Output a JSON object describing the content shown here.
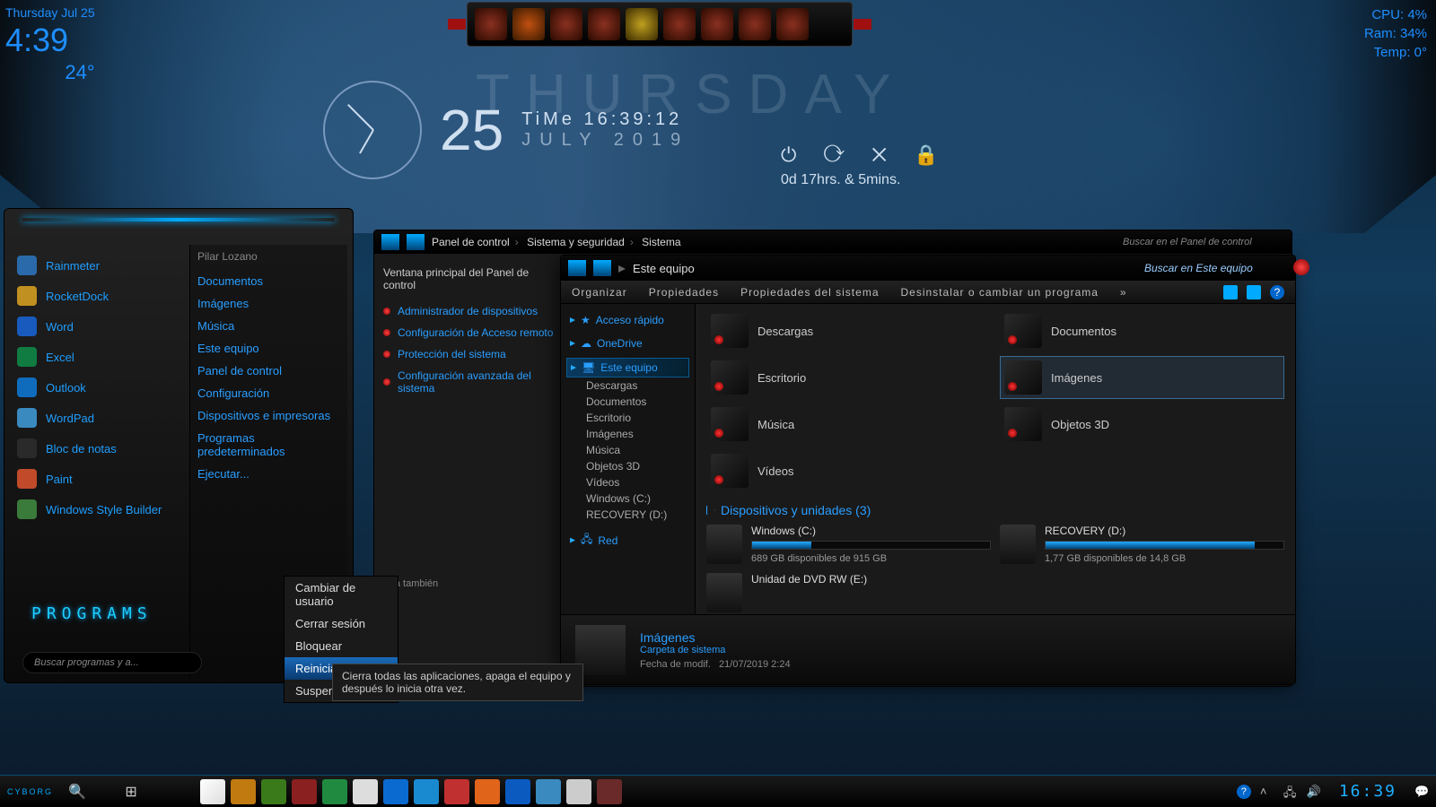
{
  "topLeft": {
    "date": "Thursday Jul 25",
    "time": "4:39",
    "temp": "24°"
  },
  "topRight": {
    "cpu": "CPU: 4%",
    "ram": "Ram: 34%",
    "temp": "Temp: 0°"
  },
  "centerClock": {
    "dayname": "THURSDAY",
    "bigday": "25",
    "timeLabel": "TiMe 16:39:12",
    "month": "JULY 2019"
  },
  "uptime": {
    "label": "0d 17hrs. & 5mins."
  },
  "startMenu": {
    "left": [
      {
        "label": "Rainmeter",
        "bg": "#2a6aaa"
      },
      {
        "label": "RocketDock",
        "bg": "#c09020"
      },
      {
        "label": "Word",
        "bg": "#185abd"
      },
      {
        "label": "Excel",
        "bg": "#107c41"
      },
      {
        "label": "Outlook",
        "bg": "#0f6cbd"
      },
      {
        "label": "WordPad",
        "bg": "#3a8ac0"
      },
      {
        "label": "Bloc de notas",
        "bg": "#2a2a2a"
      },
      {
        "label": "Paint",
        "bg": "#c04a2a"
      },
      {
        "label": "Windows Style Builder",
        "bg": "#3a7a3a"
      }
    ],
    "user": "Pilar Lozano",
    "right": [
      "Documentos",
      "Imágenes",
      "Música",
      "Este equipo",
      "Panel de control",
      "Configuración",
      "Dispositivos e impresoras",
      "Programas predeterminados",
      "Ejecutar..."
    ],
    "programs": "PROGRAMS",
    "search": "Buscar programas y a..."
  },
  "powerMenu": {
    "items": [
      "Cambiar de usuario",
      "Cerrar sesión",
      "Bloquear",
      "Reiniciar",
      "Suspen"
    ],
    "highlight": 3,
    "tooltip": "Cierra todas las aplicaciones, apaga el equipo y después lo inicia otra vez."
  },
  "controlPanel": {
    "crumbs": [
      "Panel de control",
      "Sistema y seguridad",
      "Sistema"
    ],
    "search": "Buscar en el Panel de control",
    "sideHead": "Ventana principal del Panel de control",
    "links": [
      "Administrador de dispositivos",
      "Configuración de Acceso remoto",
      "Protección del sistema",
      "Configuración avanzada del sistema"
    ],
    "seeAlso": "Vea también"
  },
  "explorer": {
    "crumb": "Este equipo",
    "search": "Buscar en Este equipo",
    "toolbar": [
      "Organizar",
      "Propiedades",
      "Propiedades del sistema",
      "Desinstalar o cambiar un programa",
      "»"
    ],
    "nav": {
      "quick": "Acceso rápido",
      "onedrive": "OneDrive",
      "pc": "Este equipo",
      "pcItems": [
        "Descargas",
        "Documentos",
        "Escritorio",
        "Imágenes",
        "Música",
        "Objetos 3D",
        "Vídeos",
        "Windows (C:)",
        "RECOVERY (D:)"
      ],
      "network": "Red"
    },
    "folders": [
      "Descargas",
      "Documentos",
      "Escritorio",
      "Imágenes",
      "Música",
      "Objetos 3D",
      "Vídeos"
    ],
    "selected": "Imágenes",
    "devicesHead": "Dispositivos y unidades (3)",
    "drives": [
      {
        "name": "Windows (C:)",
        "free": "689 GB disponibles de 915 GB",
        "pct": 25
      },
      {
        "name": "RECOVERY (D:)",
        "free": "1,77 GB disponibles de 14,8 GB",
        "pct": 88
      }
    ],
    "dvd": "Unidad de DVD RW (E:)",
    "details": {
      "name": "Imágenes",
      "type": "Carpeta de sistema",
      "dateLabel": "Fecha de modif.",
      "date": "21/07/2019 2:24"
    }
  },
  "taskbar": {
    "logo": "CYBORG",
    "clock": "16:39",
    "apps": [
      {
        "name": "store",
        "bg": "linear-gradient(135deg,#fff,#ddd)"
      },
      {
        "name": "winamp",
        "bg": "#c07a10"
      },
      {
        "name": "nvidia",
        "bg": "#3a7a1a"
      },
      {
        "name": "app1",
        "bg": "#8a2020"
      },
      {
        "name": "app2",
        "bg": "#208a40"
      },
      {
        "name": "mail",
        "bg": "#ddd"
      },
      {
        "name": "edge",
        "bg": "#0a6acf"
      },
      {
        "name": "ie",
        "bg": "#1a8ad0"
      },
      {
        "name": "ccleaner",
        "bg": "#c03030"
      },
      {
        "name": "firefox",
        "bg": "#e0641a"
      },
      {
        "name": "maxthon",
        "bg": "#0a5ac0"
      },
      {
        "name": "paint",
        "bg": "#3a8ac0"
      },
      {
        "name": "explorer",
        "bg": "#ccc"
      },
      {
        "name": "app3",
        "bg": "#6a2a2a"
      }
    ]
  }
}
